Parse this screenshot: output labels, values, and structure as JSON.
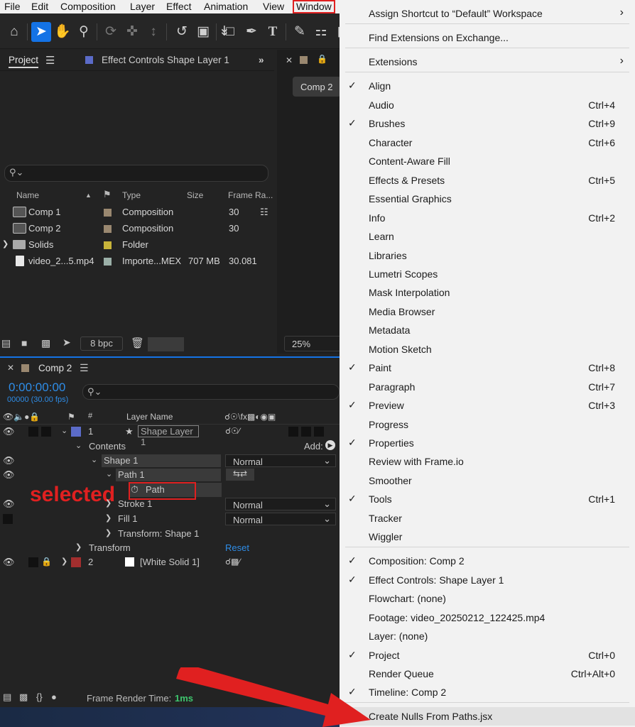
{
  "menubar": {
    "items": [
      "File",
      "Edit",
      "Composition",
      "Layer",
      "Effect",
      "Animation",
      "View",
      "Window"
    ]
  },
  "project_panel": {
    "tab_project": "Project",
    "tab_effect_controls": "Effect Controls Shape Layer 1",
    "columns": [
      "Name",
      "Type",
      "Size",
      "Frame Ra..."
    ],
    "items": [
      {
        "name": "Comp 1",
        "type": "Composition",
        "size": "",
        "fps": "30",
        "label_color": "#9a8870"
      },
      {
        "name": "Comp 2",
        "type": "Composition",
        "size": "",
        "fps": "30",
        "label_color": "#9a8870"
      },
      {
        "name": "Solids",
        "type": "Folder",
        "size": "",
        "fps": "",
        "label_color": "#c8b43a"
      },
      {
        "name": "video_2...5.mp4",
        "type": "Importe...MEX",
        "size": "707 MB",
        "fps": "30.081",
        "label_color": "#9bb0a8"
      }
    ],
    "bpc": "8 bpc"
  },
  "viewer": {
    "tab": "Comp 2",
    "zoom": "25%"
  },
  "timeline": {
    "tab": "Comp 2",
    "timecode": "0:00:00:00",
    "frames": "00000 (30.00 fps)",
    "col_num": "#",
    "col_layer_name": "Layer Name",
    "layers": [
      {
        "num": "1",
        "name": "Shape Layer 1",
        "color": "#5b6bc8"
      },
      {
        "num": "2",
        "name": "[White Solid 1]",
        "color": "#a22e2e"
      }
    ],
    "contents": "Contents",
    "add_label": "Add:",
    "shape": "Shape 1",
    "path_group": "Path 1",
    "path": "Path",
    "stroke": "Stroke 1",
    "fill": "Fill 1",
    "transform_shape": "Transform: Shape 1",
    "transform": "Transform",
    "reset": "Reset",
    "blend_normal": "Normal",
    "frame_render_label": "Frame Render Time:",
    "frame_render_value": "1ms"
  },
  "annotation": {
    "selected": "selected"
  },
  "window_menu": {
    "items": [
      {
        "label": "Assign Shortcut to “Default” Workspace",
        "shortcut": "",
        "checked": false,
        "submenu": true
      },
      {
        "label": "Find Extensions on Exchange...",
        "shortcut": "",
        "checked": false,
        "submenu": false
      },
      {
        "label": "Extensions",
        "shortcut": "",
        "checked": false,
        "submenu": true
      },
      {
        "label": "Align",
        "shortcut": "",
        "checked": true,
        "submenu": false
      },
      {
        "label": "Audio",
        "shortcut": "Ctrl+4",
        "checked": false,
        "submenu": false
      },
      {
        "label": "Brushes",
        "shortcut": "Ctrl+9",
        "checked": true,
        "submenu": false
      },
      {
        "label": "Character",
        "shortcut": "Ctrl+6",
        "checked": false,
        "submenu": false
      },
      {
        "label": "Content-Aware Fill",
        "shortcut": "",
        "checked": false,
        "submenu": false
      },
      {
        "label": "Effects & Presets",
        "shortcut": "Ctrl+5",
        "checked": false,
        "submenu": false
      },
      {
        "label": "Essential Graphics",
        "shortcut": "",
        "checked": false,
        "submenu": false
      },
      {
        "label": "Info",
        "shortcut": "Ctrl+2",
        "checked": false,
        "submenu": false
      },
      {
        "label": "Learn",
        "shortcut": "",
        "checked": false,
        "submenu": false
      },
      {
        "label": "Libraries",
        "shortcut": "",
        "checked": false,
        "submenu": false
      },
      {
        "label": "Lumetri Scopes",
        "shortcut": "",
        "checked": false,
        "submenu": false
      },
      {
        "label": "Mask Interpolation",
        "shortcut": "",
        "checked": false,
        "submenu": false
      },
      {
        "label": "Media Browser",
        "shortcut": "",
        "checked": false,
        "submenu": false
      },
      {
        "label": "Metadata",
        "shortcut": "",
        "checked": false,
        "submenu": false
      },
      {
        "label": "Motion Sketch",
        "shortcut": "",
        "checked": false,
        "submenu": false
      },
      {
        "label": "Paint",
        "shortcut": "Ctrl+8",
        "checked": true,
        "submenu": false
      },
      {
        "label": "Paragraph",
        "shortcut": "Ctrl+7",
        "checked": false,
        "submenu": false
      },
      {
        "label": "Preview",
        "shortcut": "Ctrl+3",
        "checked": true,
        "submenu": false
      },
      {
        "label": "Progress",
        "shortcut": "",
        "checked": false,
        "submenu": false
      },
      {
        "label": "Properties",
        "shortcut": "",
        "checked": true,
        "submenu": false
      },
      {
        "label": "Review with Frame.io",
        "shortcut": "",
        "checked": false,
        "submenu": false
      },
      {
        "label": "Smoother",
        "shortcut": "",
        "checked": false,
        "submenu": false
      },
      {
        "label": "Tools",
        "shortcut": "Ctrl+1",
        "checked": true,
        "submenu": false
      },
      {
        "label": "Tracker",
        "shortcut": "",
        "checked": false,
        "submenu": false
      },
      {
        "label": "Wiggler",
        "shortcut": "",
        "checked": false,
        "submenu": false
      },
      {
        "label": "Composition: Comp 2",
        "shortcut": "",
        "checked": true,
        "submenu": false
      },
      {
        "label": "Effect Controls: Shape Layer 1",
        "shortcut": "",
        "checked": true,
        "submenu": false
      },
      {
        "label": "Flowchart: (none)",
        "shortcut": "",
        "checked": false,
        "submenu": false
      },
      {
        "label": "Footage: video_20250212_122425.mp4",
        "shortcut": "",
        "checked": false,
        "submenu": false
      },
      {
        "label": "Layer: (none)",
        "shortcut": "",
        "checked": false,
        "submenu": false
      },
      {
        "label": "Project",
        "shortcut": "Ctrl+0",
        "checked": true,
        "submenu": false
      },
      {
        "label": "Render Queue",
        "shortcut": "Ctrl+Alt+0",
        "checked": false,
        "submenu": false
      },
      {
        "label": "Timeline: Comp 2",
        "shortcut": "",
        "checked": true,
        "submenu": false
      },
      {
        "label": "Create Nulls From Paths.jsx",
        "shortcut": "",
        "checked": false,
        "submenu": false
      }
    ]
  },
  "icons": {
    "check": "✓",
    "submenu_arrow": "›"
  },
  "colors": {
    "accent_blue": "#1473e6",
    "timecode_blue": "#2e8ce6",
    "annotation_red": "#e02020",
    "render_time_green": "#3ec66e"
  }
}
